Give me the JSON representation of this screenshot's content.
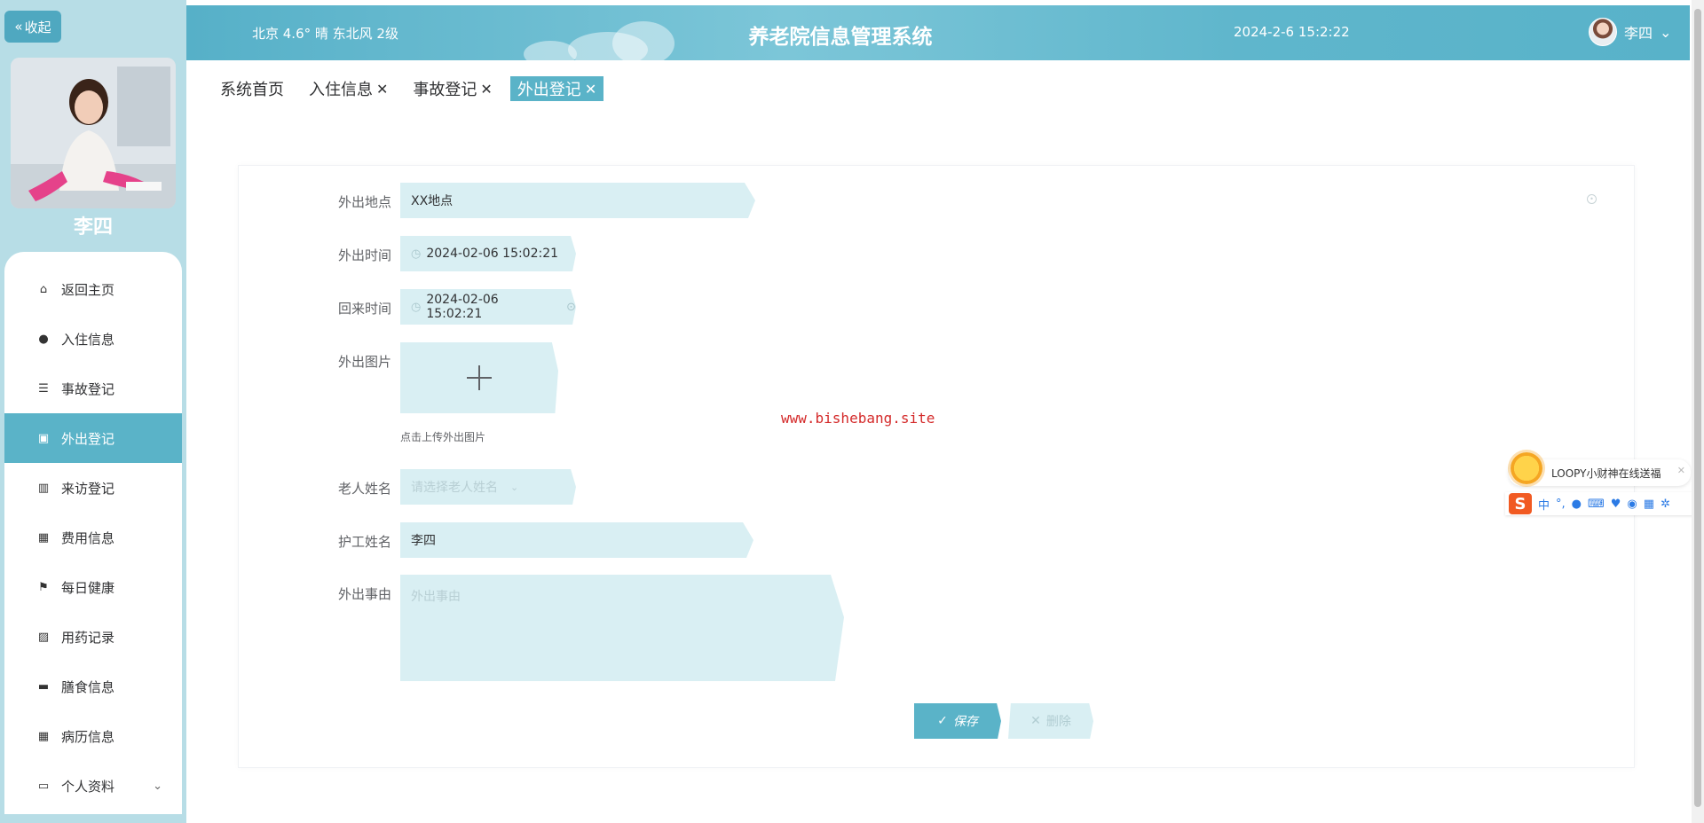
{
  "sidebar": {
    "collapse_label": "收起",
    "user_name": "李四",
    "menu": [
      {
        "label": "返回主页",
        "icon": "home-icon",
        "active": false
      },
      {
        "label": "入住信息",
        "icon": "user-icon",
        "active": false
      },
      {
        "label": "事故登记",
        "icon": "list-icon",
        "active": false
      },
      {
        "label": "外出登记",
        "icon": "clipboard-icon",
        "active": true
      },
      {
        "label": "来访登记",
        "icon": "bar-chart-icon",
        "active": false
      },
      {
        "label": "费用信息",
        "icon": "grid-icon",
        "active": false
      },
      {
        "label": "每日健康",
        "icon": "flag-icon",
        "active": false
      },
      {
        "label": "用药记录",
        "icon": "clipboard-x-icon",
        "active": false
      },
      {
        "label": "膳食信息",
        "icon": "bowl-icon",
        "active": false
      },
      {
        "label": "病历信息",
        "icon": "grid-icon",
        "active": false
      },
      {
        "label": "个人资料",
        "icon": "wallet-icon",
        "active": false
      }
    ]
  },
  "header": {
    "weather": "北京 4.6° 晴 东北风 2级",
    "title": "养老院信息管理系统",
    "datetime": "2024-2-6 15:2:22",
    "user_name": "李四"
  },
  "tabs": [
    {
      "label": "系统首页",
      "closable": false,
      "active": false
    },
    {
      "label": "入住信息",
      "closable": true,
      "active": false
    },
    {
      "label": "事故登记",
      "closable": true,
      "active": false
    },
    {
      "label": "外出登记",
      "closable": true,
      "active": true
    }
  ],
  "form": {
    "location_label": "外出地点",
    "location_value": "XX地点",
    "out_time_label": "外出时间",
    "out_time_value": "2024-02-06 15:02:21",
    "return_time_label": "回来时间",
    "return_time_value": "2024-02-06 15:02:21",
    "image_label": "外出图片",
    "image_hint": "点击上传外出图片",
    "elder_label": "老人姓名",
    "elder_placeholder": "请选择老人姓名",
    "nurse_label": "护工姓名",
    "nurse_value": "李四",
    "reason_label": "外出事由",
    "reason_placeholder": "外出事由",
    "save_label": "保存",
    "delete_label": "删除"
  },
  "watermark": "www.bishebang.site",
  "ime": {
    "bubble_text": "LOOPY小财神在线送福",
    "logo": "S",
    "mode": "中"
  }
}
